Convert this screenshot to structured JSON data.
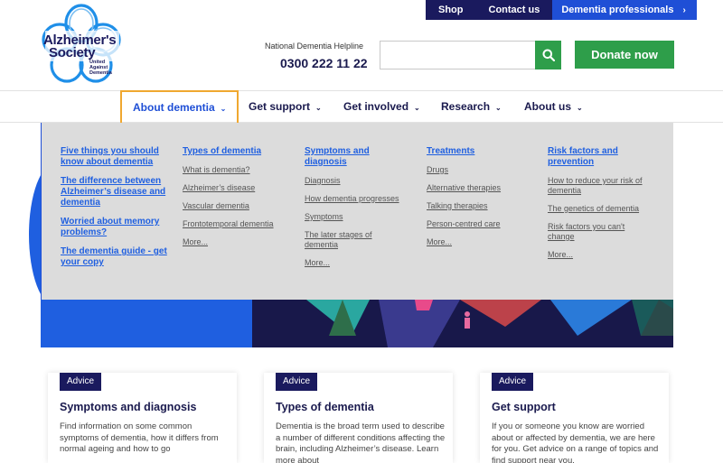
{
  "topbar": {
    "shop": "Shop",
    "contact": "Contact us",
    "professionals": "Dementia professionals",
    "professionals_arrow": "›"
  },
  "logo": {
    "line1": "Alzheimer's",
    "line2": "Society",
    "tagline": "United Against Dementia",
    "colors": {
      "petals": "#1f8fe8",
      "text": "#1a1a5e"
    }
  },
  "helpline": {
    "label": "National Dementia Helpline",
    "number": "0300 222 11 22"
  },
  "search": {
    "value": "",
    "placeholder": "",
    "icon": "search-icon"
  },
  "donate": {
    "label": "Donate now"
  },
  "nav": {
    "items": [
      {
        "label": "About dementia",
        "active": true
      },
      {
        "label": "Get support"
      },
      {
        "label": "Get involved"
      },
      {
        "label": "Research"
      },
      {
        "label": "About us"
      }
    ],
    "chevron": "⌄"
  },
  "dropdown": {
    "col1": [
      "Five things you should know about dementia",
      "The difference between Alzheimer’s disease and dementia",
      "Worried about memory problems?",
      "The dementia guide - get your copy"
    ],
    "col2": {
      "head": "Types of dementia",
      "links": [
        "What is dementia?",
        "Alzheimer’s disease",
        "Vascular dementia",
        "Frontotemporal dementia",
        "More..."
      ]
    },
    "col3": {
      "head": "Symptoms and diagnosis",
      "links": [
        "Diagnosis",
        "How dementia progresses",
        "Symptoms",
        "The later stages of dementia",
        "More..."
      ]
    },
    "col4": {
      "head": "Treatments",
      "links": [
        "Drugs",
        "Alternative therapies",
        "Talking therapies",
        "Person-centred care",
        "More..."
      ]
    },
    "col5": {
      "head": "Risk factors and prevention",
      "links": [
        "How to reduce your risk of dementia",
        "The genetics of dementia",
        "Risk factors you can't change",
        "More..."
      ]
    }
  },
  "cards": [
    {
      "badge": "Advice",
      "title": "Symptoms and diagnosis",
      "body": "Find information on some common symptoms of dementia, how it differs from normal ageing and how to go"
    },
    {
      "badge": "Advice",
      "title": "Types of dementia",
      "body": "Dementia is the broad term used to describe a number of different conditions affecting the brain, including Alzheimer’s disease. Learn more about"
    },
    {
      "badge": "Advice",
      "title": "Get support",
      "body": "If you or someone you know are worried about or affected by dementia, we are here for you. Get advice on a range of topics and find support near you."
    }
  ],
  "colors": {
    "navy": "#1a1a5e",
    "blue": "#1f4fd6",
    "green": "#2e9e4a",
    "focus": "#f0a830",
    "menu_bg": "#dcdcdc"
  }
}
